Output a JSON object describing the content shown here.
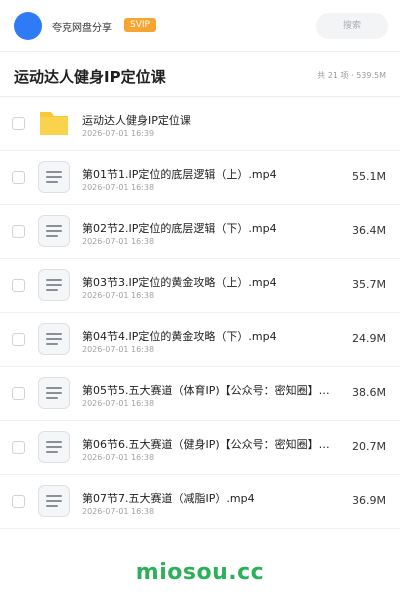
{
  "header": {
    "share_name": "夸克网盘分享",
    "badge": "SVIP",
    "search_placeholder": "搜索"
  },
  "folder": {
    "title": "运动达人健身IP定位课",
    "summary": "共 21 项 · 539.5M"
  },
  "files": [
    {
      "name": "运动达人健身IP定位课",
      "date": "2026-07-01 16:39",
      "size": "",
      "icon": "folder-icon"
    },
    {
      "name": "第01节1.IP定位的底层逻辑（上）.mp4",
      "date": "2026-07-01 16:38",
      "size": "55.1M",
      "icon": "file-icon"
    },
    {
      "name": "第02节2.IP定位的底层逻辑（下）.mp4",
      "date": "2026-07-01 16:38",
      "size": "36.4M",
      "icon": "file-icon"
    },
    {
      "name": "第03节3.IP定位的黄金攻略（上）.mp4",
      "date": "2026-07-01 16:38",
      "size": "35.7M",
      "icon": "file-icon"
    },
    {
      "name": "第04节4.IP定位的黄金攻略（下）.mp4",
      "date": "2026-07-01 16:38",
      "size": "24.9M",
      "icon": "file-icon"
    },
    {
      "name": "第05节5.五大赛道（体育IP)【公众号：密知圈】…",
      "date": "2026-07-01 16:38",
      "size": "38.6M",
      "icon": "file-icon"
    },
    {
      "name": "第06节6.五大赛道（健身IP)【公众号：密知圈】…",
      "date": "2026-07-01 16:38",
      "size": "20.7M",
      "icon": "file-icon"
    },
    {
      "name": "第07节7.五大赛道（减脂IP）.mp4",
      "date": "2026-07-01 16:38",
      "size": "36.9M",
      "icon": "file-icon"
    }
  ],
  "watermark": "miosou.cc",
  "colors": {
    "avatar": "#2f7bf6",
    "svip": "#f6a531",
    "folder": "#f7c934",
    "watermark": "#2db05a"
  }
}
